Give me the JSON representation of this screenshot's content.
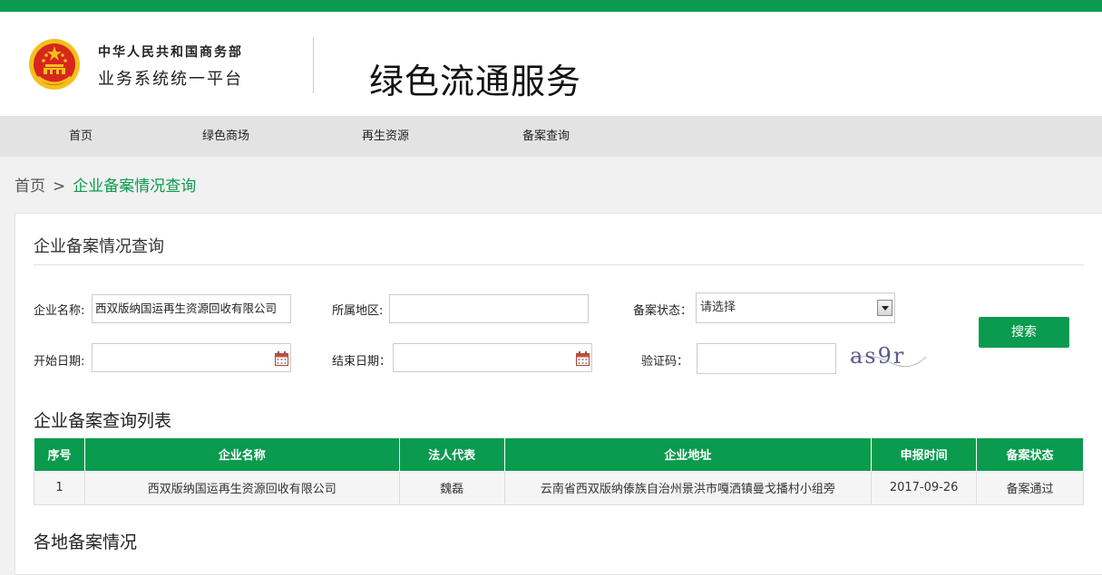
{
  "header": {
    "org_line1": "中华人民共和国商务部",
    "org_line2": "业务系统统一平台",
    "service_title": "绿色流通服务"
  },
  "nav": {
    "items": [
      {
        "label": "首页"
      },
      {
        "label": "绿色商场"
      },
      {
        "label": "再生资源"
      },
      {
        "label": "备案查询"
      }
    ]
  },
  "breadcrumb": {
    "home": "首页",
    "separator": ">",
    "current": "企业备案情况查询"
  },
  "form": {
    "title": "企业备案情况查询",
    "company_label": "企业名称:",
    "company_value": "西双版纳国运再生资源回收有限公司",
    "region_label": "所属地区:",
    "region_value": "",
    "status_label": "备案状态：",
    "status_value": "请选择",
    "start_label": "开始日期:",
    "start_value": "",
    "end_label": "结束日期：",
    "end_value": "",
    "captcha_label": "验证码：",
    "captcha_value": "",
    "captcha_text": "as9r",
    "search_label": "搜索"
  },
  "list": {
    "title": "企业备案查询列表",
    "columns": [
      "序号",
      "企业名称",
      "法人代表",
      "企业地址",
      "申报时间",
      "备案状态"
    ],
    "rows": [
      [
        "1",
        "西双版纳国运再生资源回收有限公司",
        "魏磊",
        "云南省西双版纳傣族自治州景洪市嘎洒镇曼戈播村小组旁",
        "2017-09-26",
        "备案通过"
      ]
    ]
  },
  "regions": {
    "title": "各地备案情况"
  },
  "colors": {
    "brand_green": "#0a9b4e",
    "nav_bg": "#e3e3e3",
    "emblem_red": "#d8261c",
    "emblem_gold": "#f4c11b"
  }
}
